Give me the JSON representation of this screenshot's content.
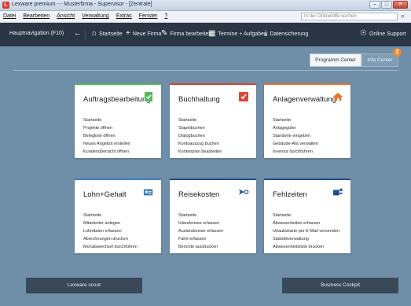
{
  "window": {
    "title": "Lexware premium - - Musterfirma - Supervisor - [Zentrale]",
    "app_icon_letter": "L",
    "controls": [
      "–",
      "□",
      "✕"
    ]
  },
  "menubar": {
    "items": [
      "Datei",
      "Bearbeiten",
      "Ansicht",
      "Verwaltung",
      "Extras",
      "Fenster",
      "?"
    ],
    "help_placeholder": "In der Onlinehilfe suchen"
  },
  "toolbar": {
    "nav_label": "Hauptnavigation (F10)",
    "buttons": [
      {
        "label": "Startseite",
        "icon": "home-icon",
        "glyph": "⌂"
      },
      {
        "label": "Neue Firma",
        "icon": "plus-icon",
        "glyph": "+"
      },
      {
        "label": "Firma bearbeiten",
        "icon": "pencil-icon",
        "glyph": "✎"
      },
      {
        "label": "Termine + Aufgaben",
        "icon": "calendar-icon",
        "glyph": "▦"
      },
      {
        "label": "Datensicherung",
        "icon": "download-icon",
        "glyph": "⤓"
      }
    ],
    "support_label": "Online Support"
  },
  "tabs": {
    "programm_center": "Programm Center",
    "info_center": "Info Center",
    "info_badge": "2"
  },
  "cards": [
    {
      "title": "Auftragsbearbeitung",
      "accent": "#5cb85c",
      "links": [
        "Startseite",
        "Projekte öffnen",
        "Belegliste öffnen",
        "Neues Angebot erstellen",
        "Kundenübersicht öffnen"
      ]
    },
    {
      "title": "Buchhaltung",
      "accent": "#d9463b",
      "links": [
        "Startseite",
        "Stapelbuchen",
        "Dialogbuchen",
        "Kontoauszug buchen",
        "Kontenplan bearbeiten"
      ]
    },
    {
      "title": "Anlagenverwaltung",
      "accent": "#e8752c",
      "links": [
        "Startseite",
        "Anlagegüter",
        "Standorte eingeben",
        "Gebäude-Afa verwalten",
        "Inventur durchführen"
      ]
    },
    {
      "title": "Lohn+Gehalt",
      "accent": "#3f7fc1",
      "links": [
        "Startseite",
        "Mitarbeiter anlegen",
        "Lohndaten erfassen",
        "Abrechnungen drucken",
        "Monatswechsel durchführen"
      ]
    },
    {
      "title": "Reisekosten",
      "accent": "#1e4f8a",
      "links": [
        "Startseite",
        "Inlandsreise erfassen",
        "Auslandsreise erfassen",
        "Fahrt erfassen",
        "Berichte ausdrucken"
      ]
    },
    {
      "title": "Fehlzeiten",
      "accent": "#1e4f8a",
      "links": [
        "Startseite",
        "Abwesenheiten erfassen",
        "Urlaubskarte per E-Mail versenden",
        "Statistikverwaltung",
        "Abwesenheitsliste drucken"
      ]
    }
  ],
  "bottom": {
    "left": "Lexware scout",
    "right": "Business Cockpit"
  }
}
